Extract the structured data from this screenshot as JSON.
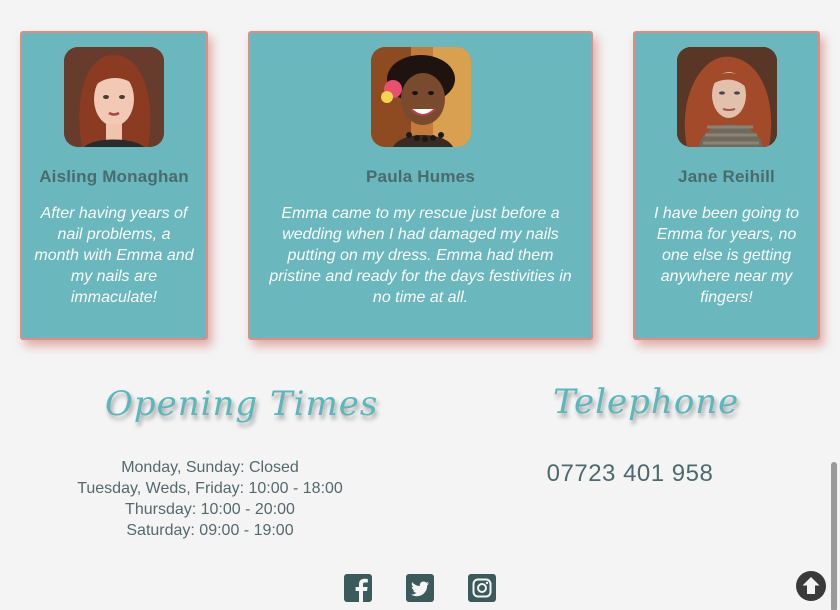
{
  "testimonials": [
    {
      "name": "Aisling Monaghan",
      "quote": "After having years of nail problems, a month with Emma and my nails are immaculate!",
      "avatar_icon": "portrait-photo"
    },
    {
      "name": "Paula Humes",
      "quote": "Emma came to my rescue just before a wedding when I had damaged my nails putting on my dress. Emma had them pristine and ready for the days festivities in no time at all.",
      "avatar_icon": "portrait-photo"
    },
    {
      "name": "Jane Reihill",
      "quote": "I have been going to Emma for years, no one else is getting anywhere near my fingers!",
      "avatar_icon": "portrait-photo"
    }
  ],
  "opening_times": {
    "heading": "Opening Times",
    "lines": [
      "Monday, Sunday: Closed",
      "Tuesday, Weds, Friday: 10:00 - 18:00",
      "Thursday: 10:00 - 20:00",
      "Saturday: 09:00 - 19:00"
    ]
  },
  "telephone": {
    "heading": "Telephone",
    "number": "07723 401 958"
  },
  "social": [
    {
      "icon": "facebook-icon"
    },
    {
      "icon": "twitter-icon"
    },
    {
      "icon": "instagram-icon"
    }
  ],
  "scroll_top_icon": "arrow-up-circle-icon",
  "colors": {
    "card_bg": "#6ab8bd",
    "card_border": "#d88f8a",
    "heading_teal": "#5ab7bc",
    "text_dark": "#54696b"
  }
}
